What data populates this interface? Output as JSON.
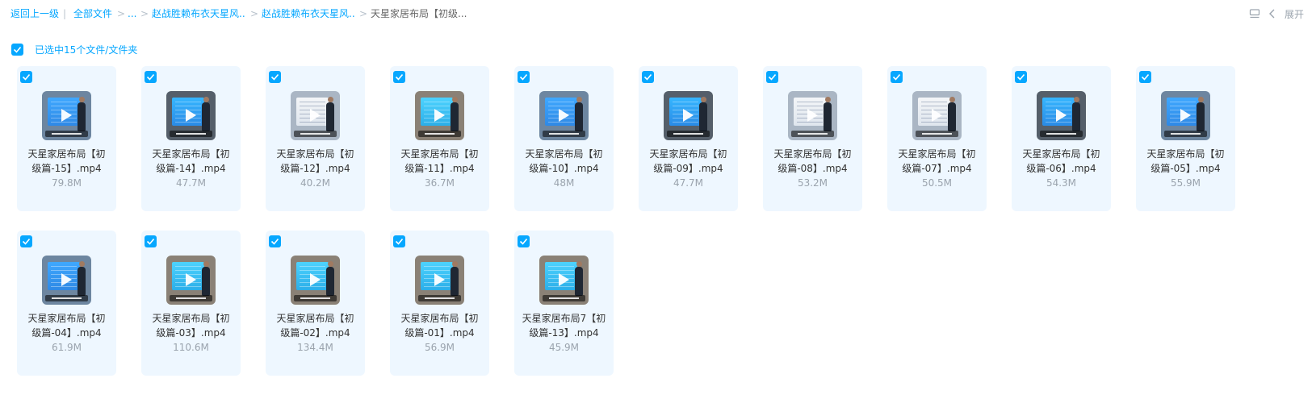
{
  "breadcrumb": {
    "back": "返回上一级",
    "all_files": "全部文件",
    "ellipsis": "...",
    "folder_1": "赵战胜赖布衣天星风...",
    "folder_2": "赵战胜赖布衣天星风...",
    "current": "天星家居布局【初级..."
  },
  "top_right": {
    "collapse_label": "展开"
  },
  "selection": {
    "text": "已选中15个文件/文件夹"
  },
  "files": [
    {
      "name": "天星家居布局【初级篇-15】.mp4",
      "size": "79.8M"
    },
    {
      "name": "天星家居布局【初级篇-14】.mp4",
      "size": "47.7M"
    },
    {
      "name": "天星家居布局【初级篇-12】.mp4",
      "size": "40.2M"
    },
    {
      "name": "天星家居布局【初级篇-11】.mp4",
      "size": "36.7M"
    },
    {
      "name": "天星家居布局【初级篇-10】.mp4",
      "size": "48M"
    },
    {
      "name": "天星家居布局【初级篇-09】.mp4",
      "size": "47.7M"
    },
    {
      "name": "天星家居布局【初级篇-08】.mp4",
      "size": "53.2M"
    },
    {
      "name": "天星家居布局【初级篇-07】.mp4",
      "size": "50.5M"
    },
    {
      "name": "天星家居布局【初级篇-06】.mp4",
      "size": "54.3M"
    },
    {
      "name": "天星家居布局【初级篇-05】.mp4",
      "size": "55.9M"
    },
    {
      "name": "天星家居布局【初级篇-04】.mp4",
      "size": "61.9M"
    },
    {
      "name": "天星家居布局【初级篇-03】.mp4",
      "size": "110.6M"
    },
    {
      "name": "天星家居布局【初级篇-02】.mp4",
      "size": "134.4M"
    },
    {
      "name": "天星家居布局【初级篇-01】.mp4",
      "size": "56.9M"
    },
    {
      "name": "天星家居布局7【初级篇-13】.mp4",
      "size": "45.9M"
    }
  ],
  "icons": {
    "checkbox": "checkbox-checked-icon",
    "view": "list-view-icon",
    "chevron": "chevron-left-icon"
  },
  "colors": {
    "accent": "#06a7ff",
    "card_bg": "#eef7ff"
  }
}
